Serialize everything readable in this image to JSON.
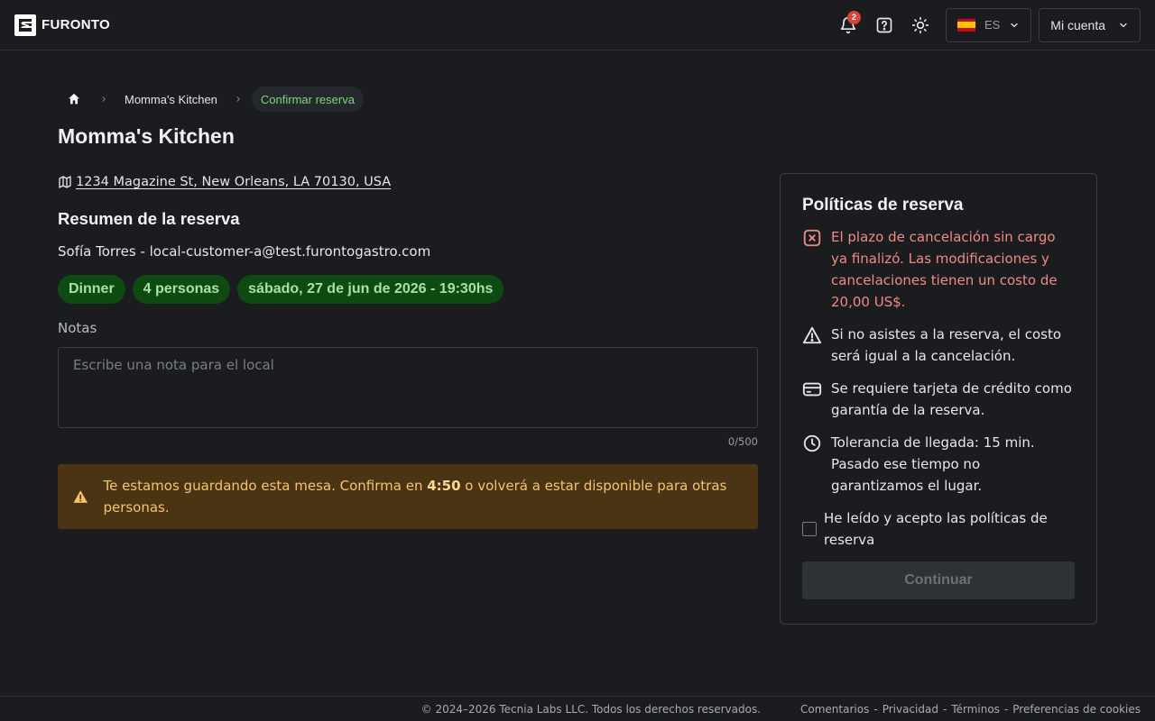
{
  "header": {
    "brand": "FURONTO",
    "notifications_count": "2",
    "language": "ES",
    "account_label": "Mi cuenta"
  },
  "breadcrumb": {
    "items": [
      "Momma's Kitchen",
      "Confirmar reserva"
    ]
  },
  "restaurant": {
    "name": "Momma's Kitchen",
    "address": "1234 Magazine St, New Orleans, LA 70130, USA"
  },
  "summary": {
    "title": "Resumen de la reserva",
    "customer": "Sofía Torres - local-customer-a@test.furontogastro.com",
    "chips": [
      "Dinner",
      "4 personas",
      "sábado, 27 de jun de 2026 - 19:30hs"
    ]
  },
  "notes": {
    "label": "Notas",
    "placeholder": "Escribe una nota para el local",
    "value": "",
    "counter": "0/500"
  },
  "hold_alert": {
    "prefix": "Te estamos guardando esta mesa. Confirma en ",
    "timer": "4:50",
    "suffix": " o volverá a estar disponible para otras personas."
  },
  "policies": {
    "title": "Políticas de reserva",
    "items": [
      "El plazo de cancelación sin cargo ya finalizó. Las modificaciones y cancelaciones tienen un costo de 20,00 US$.",
      "Si no asistes a la reserva, el costo será igual a la cancelación.",
      "Se requiere tarjeta de crédito como garantía de la reserva.",
      "Tolerancia de llegada: 15 min. Pasado ese tiempo no garantizamos el lugar."
    ],
    "accept_label": "He leído y acepto las políticas de reserva",
    "continue_label": "Continuar"
  },
  "footer": {
    "copyright": "© 2024–2026 Tecnia Labs LLC. Todos los derechos reservados.",
    "links": [
      "Comentarios",
      "Privacidad",
      "Términos",
      "Preferencias de cookies"
    ]
  },
  "colors": {
    "background": "#1a1c1f",
    "chip_bg": "#0f4a12",
    "chip_text": "#a6e3a1",
    "alert_bg": "#4a3413",
    "alert_text": "#f5c56a",
    "danger_text": "#f08a85",
    "badge": "#d9433a"
  }
}
